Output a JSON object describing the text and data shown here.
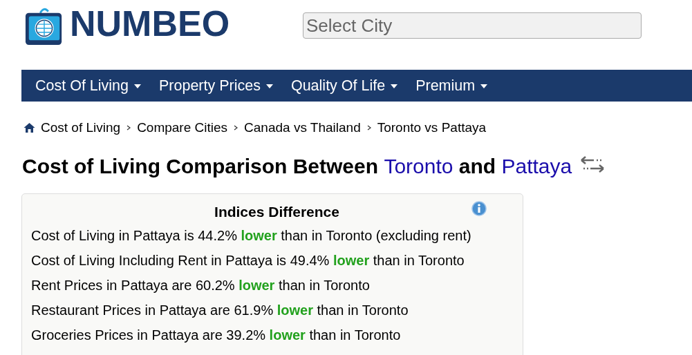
{
  "logo": {
    "text": "NUMBEO"
  },
  "search": {
    "placeholder": "Select City"
  },
  "nav": [
    {
      "label": "Cost Of Living"
    },
    {
      "label": "Property Prices"
    },
    {
      "label": "Quality Of Life"
    },
    {
      "label": "Premium"
    }
  ],
  "breadcrumb": [
    "Cost of Living",
    "Compare Cities",
    "Canada vs Thailand",
    "Toronto vs Pattaya"
  ],
  "title": {
    "prefix": "Cost of Living Comparison Between",
    "city_1": "Toronto",
    "joiner": "and",
    "city_2": "Pattaya"
  },
  "indices": {
    "heading": "Indices Difference",
    "lines": [
      "Cost of Living in Pattaya is 44.2% **lower** than in Toronto (excluding rent)",
      "Cost of Living Including Rent in Pattaya is 49.4% **lower** than in Toronto",
      "Rent Prices in Pattaya are 60.2% **lower** than in Toronto",
      "Restaurant Prices in Pattaya are 61.9% **lower** than in Toronto",
      "Groceries Prices in Pattaya are 39.2% **lower** than in Toronto"
    ]
  }
}
